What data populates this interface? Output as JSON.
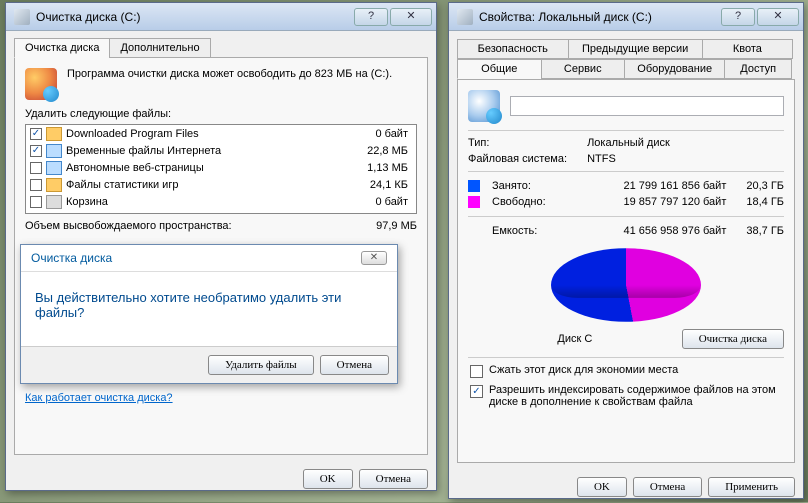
{
  "dlg1": {
    "title": "Очистка диска  (C:)",
    "tabs": [
      "Очистка диска",
      "Дополнительно"
    ],
    "intro": "Программа очистки диска может освободить до 823 МБ на  (C:).",
    "delete_label": "Удалить следующие файлы:",
    "files": [
      {
        "checked": true,
        "name": "Downloaded Program Files",
        "size": "0 байт"
      },
      {
        "checked": true,
        "name": "Временные файлы Интернета",
        "size": "22,8 МБ"
      },
      {
        "checked": false,
        "name": "Автономные веб-страницы",
        "size": "1,13 МБ"
      },
      {
        "checked": false,
        "name": "Файлы статистики игр",
        "size": "24,1 КБ"
      },
      {
        "checked": false,
        "name": "Корзина",
        "size": "0 байт"
      }
    ],
    "freed_label": "Объем высвобождаемого пространства:",
    "freed_value": "97,9 МБ",
    "help_link": "Как работает очистка диска?",
    "ok": "OK",
    "cancel": "Отмена"
  },
  "confirm": {
    "title": "Очистка диска",
    "question": "Вы действительно хотите необратимо удалить эти файлы?",
    "delete": "Удалить файлы",
    "cancel": "Отмена"
  },
  "dlg2": {
    "title": "Свойства: Локальный диск (C:)",
    "tabs_top": [
      "Безопасность",
      "Предыдущие версии",
      "Квота"
    ],
    "tabs_bot": [
      "Общие",
      "Сервис",
      "Оборудование",
      "Доступ"
    ],
    "type_label": "Тип:",
    "type_value": "Локальный диск",
    "fs_label": "Файловая система:",
    "fs_value": "NTFS",
    "used_label": "Занято:",
    "used_bytes": "21 799 161 856 байт",
    "used_gb": "20,3 ГБ",
    "free_label": "Свободно:",
    "free_bytes": "19 857 797 120 байт",
    "free_gb": "18,4 ГБ",
    "cap_label": "Емкость:",
    "cap_bytes": "41 656 958 976 байт",
    "cap_gb": "38,7 ГБ",
    "drive_label": "Диск C",
    "cleanup_btn": "Очистка диска",
    "compress": "Сжать этот диск для экономии места",
    "index": "Разрешить индексировать содержимое файлов на этом диске в дополнение к свойствам файла",
    "ok": "OK",
    "cancel": "Отмена",
    "apply": "Применить"
  },
  "chart_data": {
    "type": "pie",
    "title": "Диск C",
    "series": [
      {
        "name": "Занято",
        "value": 21799161856,
        "label": "20,3 ГБ",
        "color": "#0020e0"
      },
      {
        "name": "Свободно",
        "value": 19857797120,
        "label": "18,4 ГБ",
        "color": "#e000e0"
      }
    ],
    "total": {
      "name": "Емкость",
      "value": 41656958976,
      "label": "38,7 ГБ"
    }
  }
}
